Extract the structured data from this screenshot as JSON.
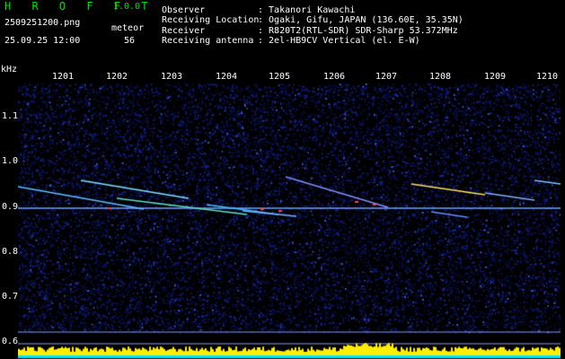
{
  "app": {
    "name": "H R O F F T",
    "version": "1.0.0"
  },
  "file": {
    "name": "2509251200.png",
    "datetime": "25.09.25 12:00"
  },
  "meteor": {
    "label": "meteor",
    "count": "56"
  },
  "info": {
    "observer_label": "Observer",
    "observer_value": ": Takanori Kawachi",
    "location_label": "Receiving Location",
    "location_value": ": Ogaki, Gifu, JAPAN (136.60E, 35.35N)",
    "receiver_label": "Receiver",
    "receiver_value": ": R820T2(RTL-SDR) SDR-Sharp 53.372MHz",
    "antenna_label": "Receiving antenna",
    "antenna_value": ": 2el-HB9CV Vertical (el. E-W)"
  },
  "axis": {
    "unit": "kHz",
    "x_ticks": [
      "1201",
      "1202",
      "1203",
      "1204",
      "1205",
      "1206",
      "1207",
      "1208",
      "1209",
      "1210"
    ],
    "y_ticks": [
      "1.1",
      "1.0",
      "0.9",
      "0.8",
      "0.7",
      "0.6"
    ]
  },
  "colors": {
    "background": "#000000",
    "text": "#ffffff",
    "brand": "#00e000",
    "noise": "#0a1670",
    "carrier": "#6fa0ff",
    "trail_hot": "#ff4040",
    "histogram": "#ffee00",
    "histogram_base": "#00e5ff"
  }
}
